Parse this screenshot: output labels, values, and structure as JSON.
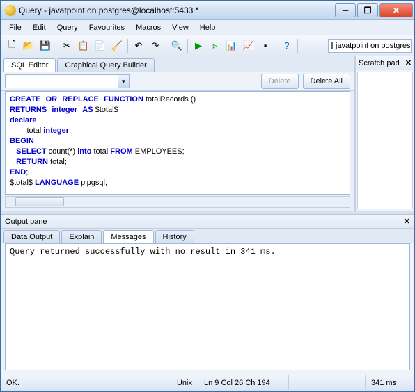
{
  "window": {
    "title": "Query - javatpoint on postgres@localhost:5433 *"
  },
  "menu": {
    "file": "File",
    "edit": "Edit",
    "query": "Query",
    "favourites": "Favourites",
    "macros": "Macros",
    "view": "View",
    "help": "Help"
  },
  "db_selector": {
    "label": "javatpoint on postgres@l"
  },
  "editor_tabs": {
    "sql": "SQL Editor",
    "gqb": "Graphical Query Builder"
  },
  "editor_actions": {
    "delete": "Delete",
    "delete_all": "Delete All"
  },
  "scratch": {
    "title": "Scratch pad"
  },
  "sql": {
    "l1a": "CREATE",
    "l1b": "OR",
    "l1c": "REPLACE",
    "l1d": "FUNCTION",
    "l1e": " totalRecords ()",
    "l2a": "RETURNS",
    "l2b": "integer",
    "l2c": "AS",
    "l2d": " $total$",
    "l3a": "declare",
    "l4a": "        total ",
    "l4b": "integer",
    "l4c": ";",
    "l5a": "BEGIN",
    "l6a": "   ",
    "l6b": "SELECT",
    "l6c": " count(*) ",
    "l6d": "into",
    "l6e": " total ",
    "l6f": "FROM",
    "l6g": " EMPLOYEES;",
    "l7a": "   ",
    "l7b": "RETURN",
    "l7c": " total;",
    "l8a": "END",
    "l8b": ";",
    "l9a": "$total$ ",
    "l9b": "LANGUAGE",
    "l9c": " plpgsql;"
  },
  "output": {
    "title": "Output pane",
    "tabs": {
      "data": "Data Output",
      "explain": "Explain",
      "messages": "Messages",
      "history": "History"
    },
    "message": "Query returned successfully with no result in 341 ms."
  },
  "status": {
    "ok": "OK.",
    "mode": "Unix",
    "pos": "Ln 9 Col 26 Ch 194",
    "time": "341 ms"
  }
}
